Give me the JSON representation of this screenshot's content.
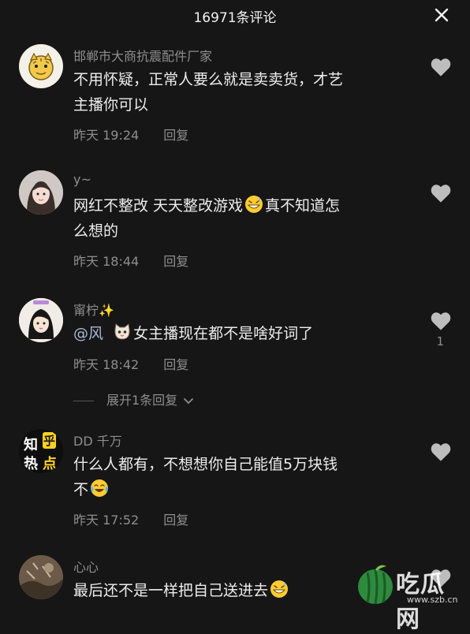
{
  "header": {
    "title": "16971条评论",
    "close_icon": "close-icon"
  },
  "comments": [
    {
      "username": "邯郸市大商抗震配件厂家",
      "text_line1": "不用怀疑，正常人要么就是卖卖货，才艺",
      "text_line2": "主播你可以",
      "time": "昨天 19:24",
      "reply": "回复"
    },
    {
      "username": "y~",
      "text_line1": "网红不整改 天天整改游戏",
      "text_after_emoji": "真不知道怎",
      "text_line2": "么想的",
      "time": "昨天 18:44",
      "reply": "回复"
    },
    {
      "username": "甯柠✨",
      "mention": "@风",
      "text_after_emoji": "女主播现在都不是啥好词了",
      "time": "昨天 18:42",
      "reply": "回复",
      "like_count": "1",
      "expand_replies": "展开1条回复"
    },
    {
      "username": "DD 千万",
      "avatar_text_1": "知",
      "avatar_text_2": "乎",
      "avatar_text_3": "热",
      "avatar_text_4": "点",
      "text_line1": "什么人都有，不想想你自己能值5万块钱",
      "text_line2": "不",
      "time": "昨天 17:52",
      "reply": "回复"
    },
    {
      "username": "心心",
      "text_line1": "最后还不是一样把自己送进去"
    }
  ],
  "watermark": {
    "text": "吃瓜网",
    "url": "www.szb.cn"
  },
  "icons": {
    "like": "heart-icon",
    "close": "close-icon",
    "chevron": "chevron-down-icon"
  },
  "colors": {
    "background": "#161616",
    "text": "#ededed",
    "secondary": "#8e8e8e",
    "mention": "#a9b7d6"
  }
}
